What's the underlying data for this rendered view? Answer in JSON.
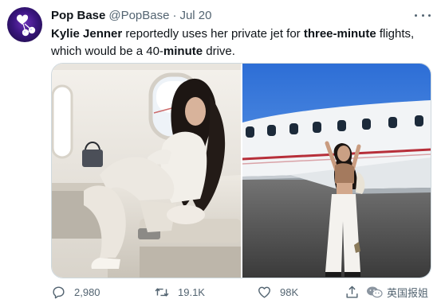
{
  "author": {
    "name": "Pop Base",
    "handle": "@PopBase",
    "separator": "·",
    "date": "Jul 20"
  },
  "tweet": {
    "segments": [
      {
        "text": "Kylie Jenner",
        "bold": true
      },
      {
        "text": " reportedly uses her private jet for ",
        "bold": false
      },
      {
        "text": "three-minute",
        "bold": true
      },
      {
        "text": " flights, which would be a 40-",
        "bold": false
      },
      {
        "text": "minute",
        "bold": true
      },
      {
        "text": " drive.",
        "bold": false
      }
    ]
  },
  "media": {
    "left_image": "woman-seated-in-jet-cabin",
    "right_image": "woman-posing-beside-private-jet"
  },
  "actions": {
    "reply_count": "2,980",
    "retweet_count": "19.1K",
    "like_count": "98K"
  },
  "watermark": {
    "label": "英国报姐"
  },
  "colors": {
    "text": "#0f1419",
    "secondary": "#536471",
    "border": "#cfd9de"
  }
}
